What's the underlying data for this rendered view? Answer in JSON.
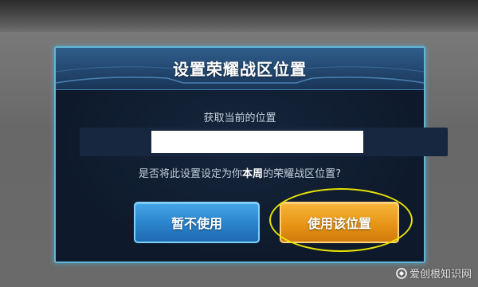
{
  "dialog": {
    "title": "设置荣耀战区位置",
    "location_label": "获取当前的位置",
    "location_value": "",
    "question_pre": "是否将此设置设定为你",
    "question_bold": "本周",
    "question_post": "的荣耀战区位置?",
    "cancel_label": "暂不使用",
    "confirm_label": "使用该位置"
  },
  "annotation": {
    "ring_color": "#e8e300"
  },
  "watermark": {
    "text": "爱创根知识网"
  },
  "colors": {
    "dialog_border": "#5fb7d6",
    "header": "#23476f",
    "cancel_button": "#2a82ca",
    "confirm_button": "#e89516"
  }
}
